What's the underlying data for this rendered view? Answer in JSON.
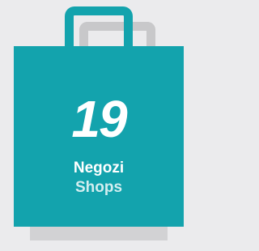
{
  "card": {
    "count": "19",
    "label_primary": "Negozi",
    "label_secondary": "Shops"
  },
  "colors": {
    "bag": "#13a3ad",
    "bag_shadow": "#d2d2d4",
    "handle_shadow": "#c8c8ca",
    "background": "#ebebed",
    "text_primary": "#ffffff",
    "text_secondary": "#d3eef0"
  },
  "icons": {
    "main": "shopping-bag-icon"
  }
}
